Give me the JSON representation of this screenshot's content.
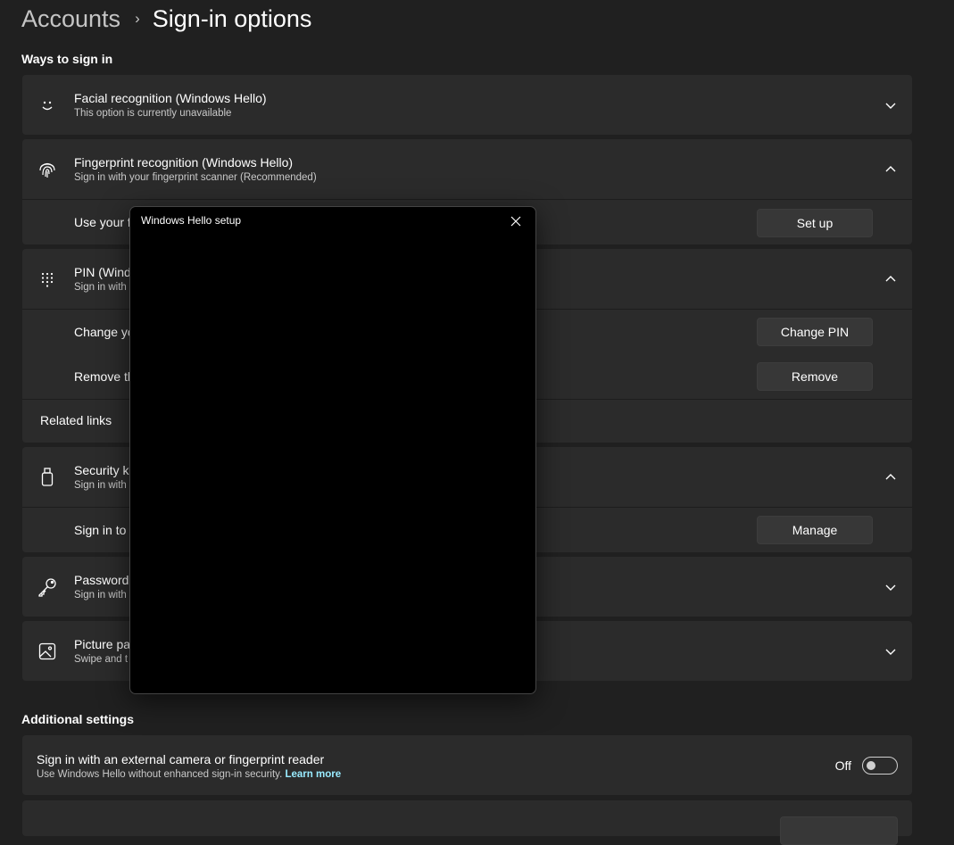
{
  "breadcrumb": {
    "parent": "Accounts",
    "separator": "›",
    "current": "Sign-in options"
  },
  "ways_title": "Ways to sign in",
  "facial": {
    "title": "Facial recognition (Windows Hello)",
    "subtitle": "This option is currently unavailable"
  },
  "fingerprint": {
    "title": "Fingerprint recognition (Windows Hello)",
    "subtitle": "Sign in with your fingerprint scanner (Recommended)",
    "row_label": "Use your f",
    "button": "Set up"
  },
  "pin": {
    "title": "PIN (Wind",
    "subtitle": "Sign in with",
    "change_label": "Change yo",
    "change_button": "Change PIN",
    "remove_label": "Remove th",
    "remove_button": "Remove",
    "related": "Related links"
  },
  "security_key": {
    "title": "Security k",
    "subtitle": "Sign in with",
    "row_label": "Sign in to",
    "button": "Manage"
  },
  "password": {
    "title": "Password",
    "subtitle": "Sign in with"
  },
  "picture": {
    "title": "Picture pa",
    "subtitle": "Swipe and t"
  },
  "additional_title": "Additional settings",
  "external": {
    "title": "Sign in with an external camera or fingerprint reader",
    "subtitle": "Use Windows Hello without enhanced sign-in security.",
    "link": "Learn more",
    "toggle_label": "Off",
    "toggle_on": false
  },
  "dialog": {
    "title": "Windows Hello setup"
  },
  "icons": [
    "smile-icon",
    "fingerprint-icon",
    "keypad-icon",
    "usb-key-icon",
    "key-icon",
    "picture-icon",
    "chevron-down-icon",
    "chevron-up-icon",
    "close-icon"
  ]
}
